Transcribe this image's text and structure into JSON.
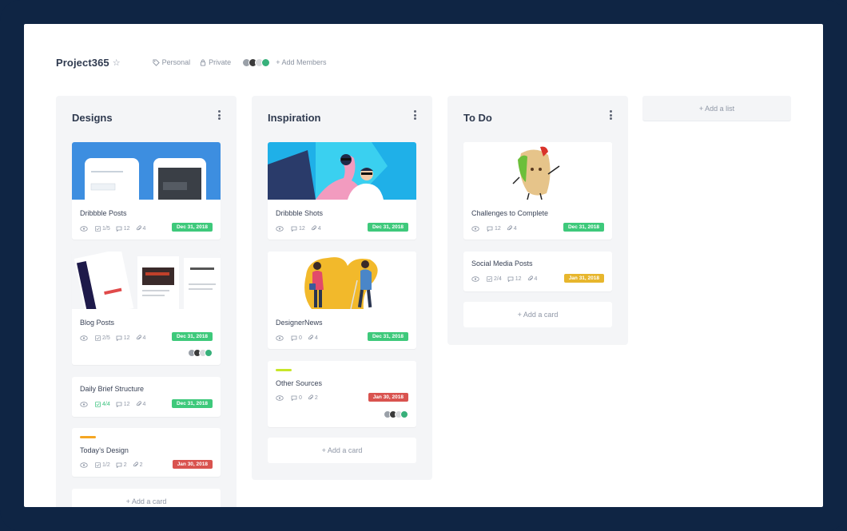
{
  "header": {
    "title": "Project365",
    "visibility_personal": "Personal",
    "visibility_private": "Private",
    "add_members": "+ Add Members",
    "member_colors": [
      "#9aa0a8",
      "#3a3a3a",
      "#d8dadd",
      "#37b07a"
    ]
  },
  "lists": [
    {
      "title": "Designs",
      "cards": [
        {
          "title": "Dribbble Posts",
          "image": "mobile-app-screens",
          "checklist": "1/5",
          "comments": "12",
          "attachments": "4",
          "due": "Dec 31, 2018",
          "due_color": "#3ec97b"
        },
        {
          "title": "Blog Posts",
          "image": "news-website-pages",
          "checklist": "2/5",
          "comments": "12",
          "attachments": "4",
          "due": "Dec 31, 2018",
          "due_color": "#3ec97b",
          "members": true
        },
        {
          "title": "Daily Brief Structure",
          "checklist": "4/4",
          "checklist_done": true,
          "comments": "12",
          "attachments": "4",
          "due": "Dec 31, 2018",
          "due_color": "#3ec97b"
        },
        {
          "title": "Today’s Design",
          "label_color": "#f5a623",
          "checklist": "1/2",
          "comments": "2",
          "attachments": "2",
          "due": "Jan 30, 2018",
          "due_color": "#d9534f"
        }
      ],
      "add_card": "+ Add a card"
    },
    {
      "title": "Inspiration",
      "cards": [
        {
          "title": "Dribbble Shots",
          "image": "people-selfie-illustration",
          "comments": "12",
          "attachments": "4",
          "due": "Dec 31, 2018",
          "due_color": "#3ec97b"
        },
        {
          "title": "DesignerNews",
          "image": "walking-people-illustration",
          "comments": "0",
          "attachments": "4",
          "due": "Dec 31, 2018",
          "due_color": "#3ec97b"
        },
        {
          "title": "Other Sources",
          "label_color": "#c8e629",
          "comments": "0",
          "attachments": "2",
          "due": "Jan 30, 2018",
          "due_color": "#d9534f",
          "members": true
        }
      ],
      "add_card": "+ Add a card"
    },
    {
      "title": "To Do",
      "cards": [
        {
          "title": "Challenges to Complete",
          "image": "sandwich-character",
          "comments": "12",
          "attachments": "4",
          "due": "Dec 31, 2018",
          "due_color": "#3ec97b"
        },
        {
          "title": "Social Media Posts",
          "checklist": "2/4",
          "comments": "12",
          "attachments": "4",
          "due": "Jan 31, 2018",
          "due_color": "#e7b62d"
        }
      ],
      "add_card": "+ Add a card"
    }
  ],
  "add_list": "+ Add a list"
}
